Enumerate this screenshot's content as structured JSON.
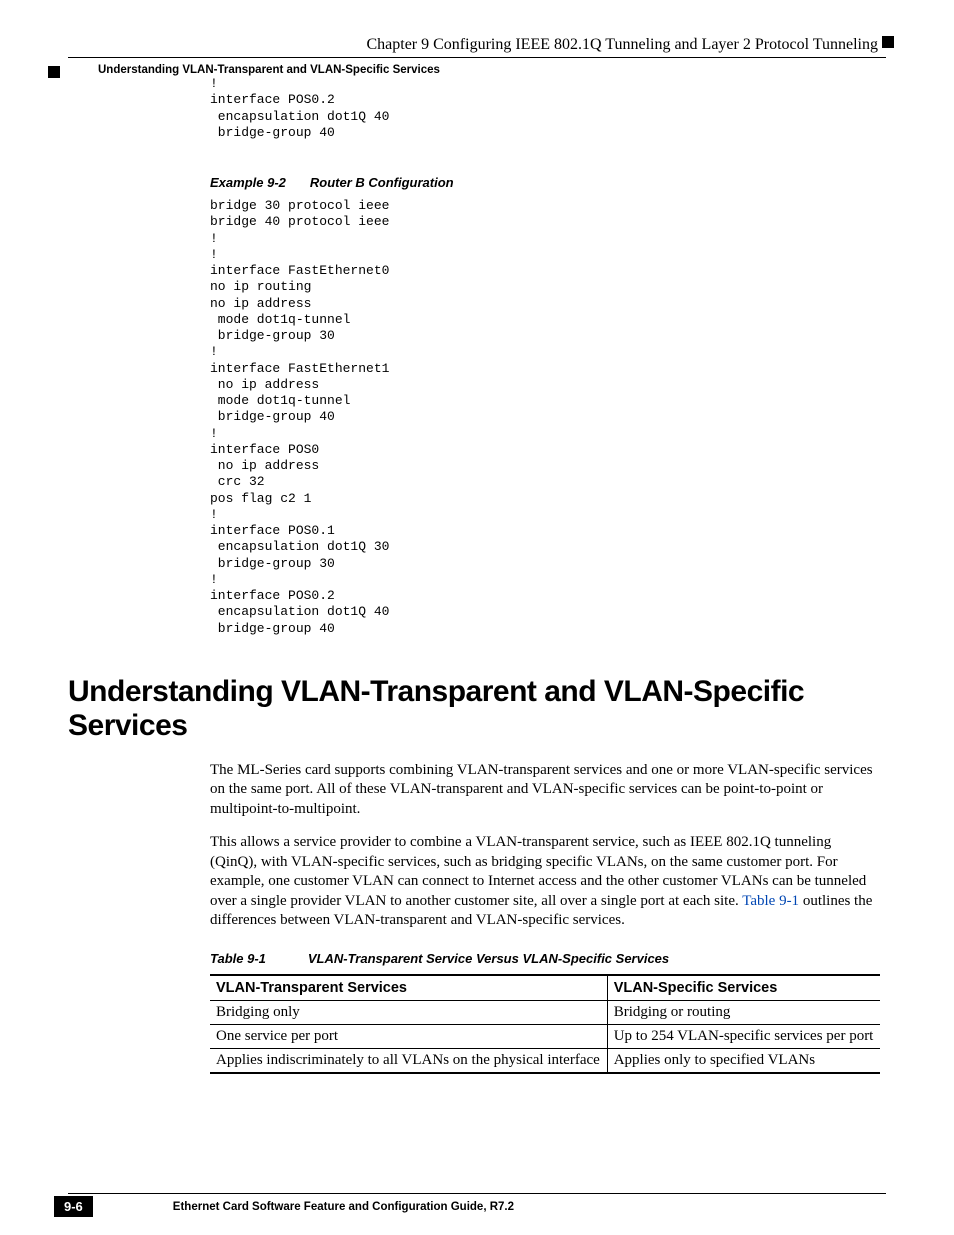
{
  "header": {
    "chapter_line": "Chapter 9 Configuring IEEE 802.1Q Tunneling and Layer 2 Protocol Tunneling",
    "section_line": "Understanding VLAN-Transparent and VLAN-Specific Services"
  },
  "code_block_1": "!\ninterface POS0.2\n encapsulation dot1Q 40\n bridge-group 40",
  "example": {
    "label": "Example 9-2",
    "title": "Router B Configuration",
    "code": "bridge 30 protocol ieee\nbridge 40 protocol ieee\n!\n!\ninterface FastEthernet0\nno ip routing\nno ip address\n mode dot1q-tunnel\n bridge-group 30\n!\ninterface FastEthernet1\n no ip address\n mode dot1q-tunnel\n bridge-group 40\n!\ninterface POS0\n no ip address\n crc 32\npos flag c2 1\n!\ninterface POS0.1\n encapsulation dot1Q 30\n bridge-group 30\n!\ninterface POS0.2\n encapsulation dot1Q 40\n bridge-group 40"
  },
  "section_heading": "Understanding VLAN-Transparent and VLAN-Specific Services",
  "para1": "The ML-Series card supports combining VLAN-transparent services and one or more VLAN-specific services on the same port. All of these VLAN-transparent and VLAN-specific services can be point-to-point or multipoint-to-multipoint.",
  "para2_pre": "This allows a service provider to combine a VLAN-transparent service, such as IEEE 802.1Q tunneling (QinQ), with VLAN-specific services, such as bridging specific VLANs, on the same customer port. For example, one customer VLAN can connect to Internet access and the other customer VLANs can be tunneled over a single provider VLAN to another customer site, all over a single port at each site. ",
  "para2_xref": "Table 9-1",
  "para2_post": " outlines the differences between VLAN-transparent and VLAN-specific services.",
  "table": {
    "label": "Table 9-1",
    "title": "VLAN-Transparent Service Versus VLAN-Specific Services",
    "headers": [
      "VLAN-Transparent Services",
      "VLAN-Specific Services"
    ],
    "rows": [
      [
        "Bridging only",
        "Bridging or routing"
      ],
      [
        "One service per port",
        "Up to 254 VLAN-specific services per port"
      ],
      [
        "Applies indiscriminately to all VLANs on the physical interface",
        "Applies only to specified VLANs"
      ]
    ]
  },
  "footer": {
    "doc_title": "Ethernet Card Software Feature and Configuration Guide, R7.2",
    "page_number": "9-6"
  }
}
